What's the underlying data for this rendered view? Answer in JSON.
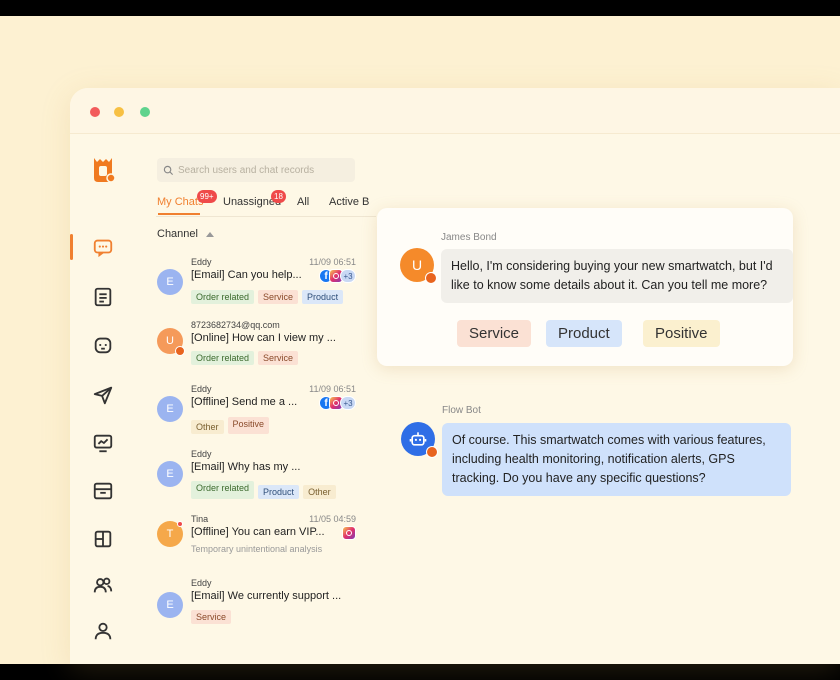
{
  "search": {
    "placeholder": "Search users and chat records"
  },
  "tabs": [
    {
      "label": "My Chats",
      "badge": "99+"
    },
    {
      "label": "Unassigned",
      "badge": "18"
    },
    {
      "label": "All"
    },
    {
      "label": "Active B"
    }
  ],
  "channel_label": "Channel",
  "chats": [
    {
      "name": "Eddy",
      "time": "11/09 06:51",
      "message": "[Email] Can you help...",
      "avatar": "E",
      "tags": [
        "Order related",
        "Service",
        "Product"
      ],
      "extra_channels": "+3"
    },
    {
      "name": "8723682734@qq.com",
      "time": "",
      "message": "[Online] How can I view my ...",
      "avatar": "U",
      "tags": [
        "Order related",
        "Service"
      ]
    },
    {
      "name": "Eddy",
      "time": "11/09 06:51",
      "message": "[Offline] Send me a ...",
      "avatar": "E",
      "tags": [
        "Other",
        "Positive"
      ],
      "extra_channels": "+3"
    },
    {
      "name": "Eddy",
      "time": "",
      "message": "[Email] Why has my ...",
      "avatar": "E",
      "tags": [
        "Order related",
        "Product",
        "Other"
      ]
    },
    {
      "name": "Tina",
      "time": "11/05 04:59",
      "message": "[Offline] You can earn VIP...",
      "avatar": "T",
      "subtext": "Temporary unintentional analysis"
    },
    {
      "name": "Eddy",
      "time": "",
      "message": "[Email] We currently support ...",
      "avatar": "E",
      "tags": [
        "Service"
      ]
    }
  ],
  "conversation": {
    "customer_name": "James Bond",
    "customer_avatar": "U",
    "customer_message": "Hello, I'm considering buying your new smartwatch, but I'd like to know some details about it. Can you tell me more?",
    "tags": [
      "Service",
      "Product",
      "Positive"
    ],
    "bot_name": "Flow Bot",
    "bot_message": "Of course. This smartwatch comes with various features, including health monitoring, notification alerts, GPS tracking. Do you have any specific questions?"
  },
  "colors": {
    "accent": "#f08030",
    "badge": "#ef4a4a",
    "bot_bubble": "#cfe1fb"
  },
  "icons": [
    "logo-icon",
    "chat-icon",
    "document-icon",
    "bot-face-icon",
    "send-icon",
    "analytics-icon",
    "inbox-icon",
    "layout-icon",
    "team-icon",
    "user-icon",
    "search-icon"
  ]
}
